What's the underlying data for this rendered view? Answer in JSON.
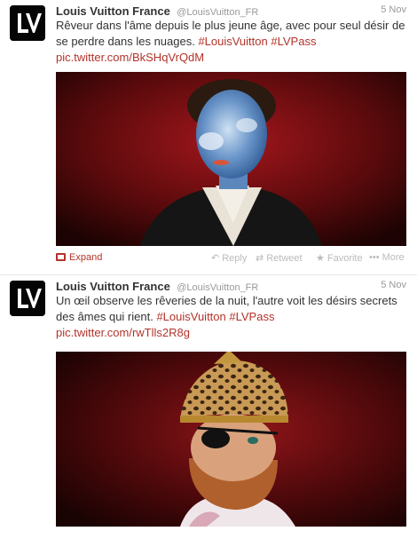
{
  "tweets": [
    {
      "name": "Louis Vuitton France",
      "handle": "@LouisVuitton_FR",
      "time": "5 Nov",
      "text_plain": "Rêveur dans l'âme depuis le plus jeune âge, avec pour seul désir de se perdre dans les nuages. ",
      "hashtag1": "#LouisVuitton",
      "hashtag2": "#LVPass",
      "link": "pic.twitter.com/BkSHqVrQdM",
      "image_desc": "man with blue cloud-painted face in dark suit",
      "actions": {
        "expand": "Expand",
        "reply": "Reply",
        "retweet": "Retweet",
        "favorite": "Favorite",
        "more": "More"
      }
    },
    {
      "name": "Louis Vuitton France",
      "handle": "@LouisVuitton_FR",
      "time": "5 Nov",
      "text_plain": "Un œil observe les rêveries de la nuit, l'autre voit les désirs secrets des âmes qui rient. ",
      "hashtag1": "#LouisVuitton",
      "hashtag2": "#LVPass",
      "link": "pic.twitter.com/rwTlls2R8g",
      "image_desc": "bearded man in leopard-print helmet with eye patch"
    }
  ],
  "icons": {
    "avatar": "lv-logo-icon",
    "expand": "media-icon",
    "reply": "reply-icon",
    "retweet": "retweet-icon",
    "favorite": "star-icon",
    "more": "ellipsis-icon"
  },
  "colors": {
    "link": "#b2332a",
    "muted": "#999999",
    "text": "#333333"
  }
}
